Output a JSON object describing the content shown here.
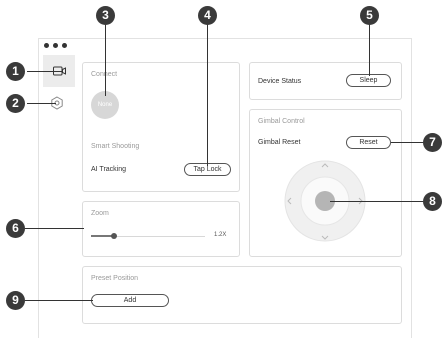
{
  "window_controls": [
    "close",
    "minimize",
    "maximize"
  ],
  "sidebar": {
    "items": [
      {
        "icon": "camera-icon",
        "active": true
      },
      {
        "icon": "settings-gear-icon",
        "active": false
      }
    ]
  },
  "connect_panel": {
    "title": "Connect",
    "device_placeholder": "None",
    "smart_shooting_title": "Smart Shooting",
    "ai_tracking_label": "AI Tracking",
    "tap_lock_button": "Tap Lock"
  },
  "zoom_panel": {
    "title": "Zoom",
    "value_label": "1.2X",
    "slider_fraction": 0.2
  },
  "device_status_panel": {
    "label": "Device Status",
    "sleep_button": "Sleep"
  },
  "gimbal_panel": {
    "title": "Gimbal Control",
    "reset_label": "Gimbal Reset",
    "reset_button": "Reset",
    "joystick_arrows": [
      "up",
      "down",
      "left",
      "right"
    ]
  },
  "preset_panel": {
    "title": "Preset Position",
    "add_button": "Add"
  },
  "callouts": [
    "1",
    "2",
    "3",
    "4",
    "5",
    "6",
    "7",
    "8",
    "9"
  ],
  "colors": {
    "panel_border": "#dcdcdc",
    "callout_bg": "#3a3a3a",
    "muted_text": "#9a9a9a",
    "active_nav_bg": "#ececec"
  }
}
